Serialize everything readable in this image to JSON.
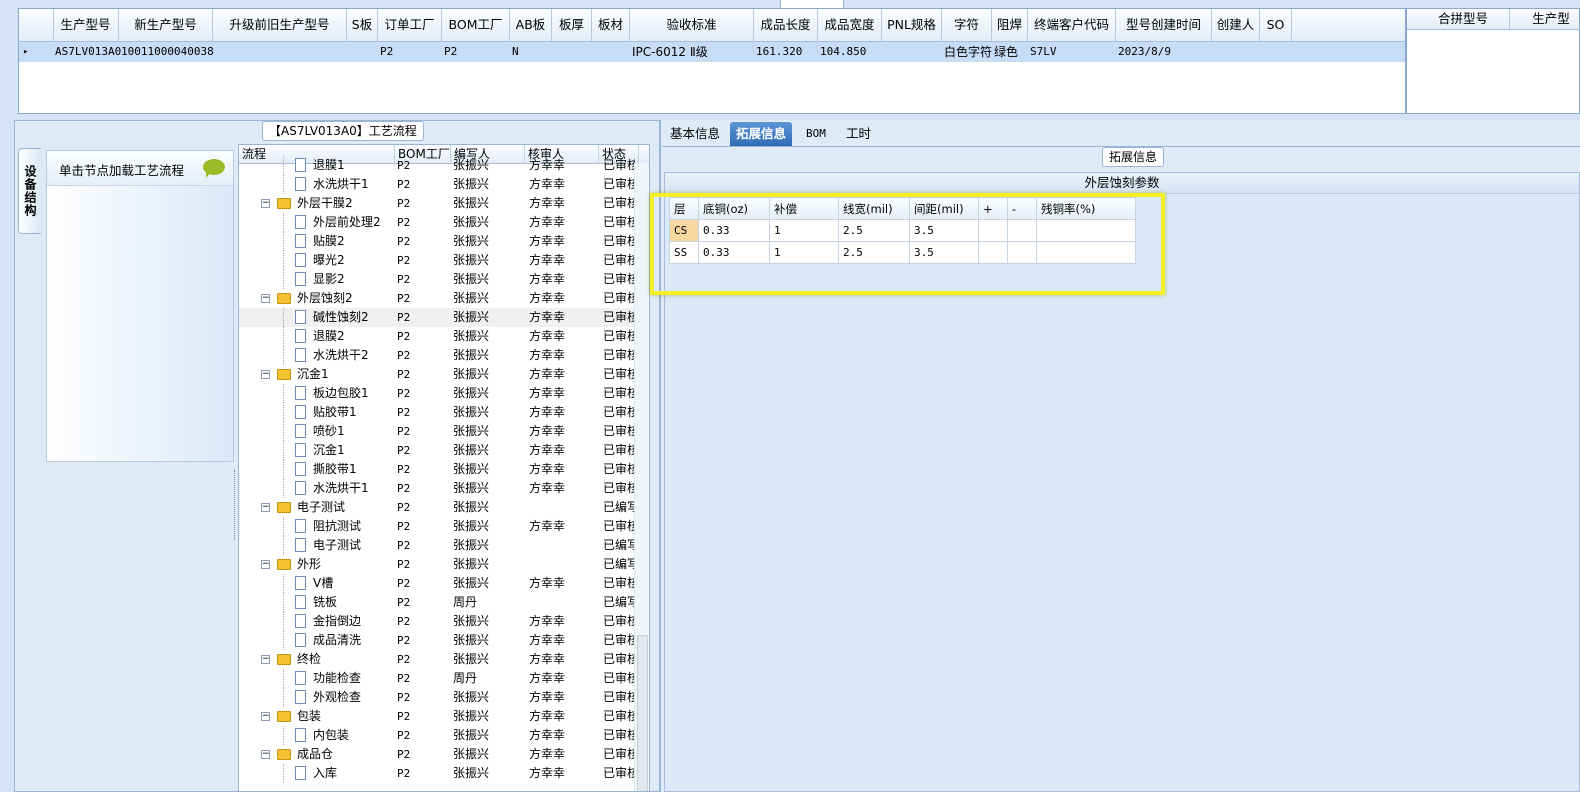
{
  "top_grid": {
    "columns": [
      "生产型号",
      "新生产型号",
      "升级前旧生产型号",
      "S板",
      "订单工厂",
      "BOM工厂",
      "AB板",
      "板厚",
      "板材",
      "验收标准",
      "成品长度",
      "成品宽度",
      "PNL规格",
      "字符",
      "阻焊",
      "终端客户代码",
      "型号创建时间",
      "创建人",
      "SO"
    ],
    "row": [
      "AS7LV013A0",
      "10011000040038",
      "",
      "",
      "P2",
      "P2",
      "N",
      "",
      "",
      "IPC-6012 Ⅱ级",
      "161.320",
      "104.850",
      "",
      "白色字符",
      "绿色",
      "S7LV",
      "2023/8/9",
      "",
      ""
    ]
  },
  "right_grid": {
    "columns": [
      "合拼型号",
      "生产型"
    ]
  },
  "left_panel": {
    "title": "【AS7LV013A0】工艺流程",
    "vertical_tab": "设备结构",
    "hint": "单击节点加载工艺流程"
  },
  "tree": {
    "columns": [
      "流程",
      "BOM工厂",
      "编写人",
      "核审人",
      "状态"
    ],
    "rows": [
      {
        "name": "退膜1",
        "level": 2,
        "factory": "P2",
        "writer": "张振兴",
        "reviewer": "方幸幸",
        "status": "已审核"
      },
      {
        "name": "水洗烘干1",
        "level": 2,
        "factory": "P2",
        "writer": "张振兴",
        "reviewer": "方幸幸",
        "status": "已审核"
      },
      {
        "name": "外层干膜2",
        "level": 1,
        "factory": "P2",
        "writer": "张振兴",
        "reviewer": "方幸幸",
        "status": "已审核"
      },
      {
        "name": "外层前处理2",
        "level": 2,
        "factory": "P2",
        "writer": "张振兴",
        "reviewer": "方幸幸",
        "status": "已审核"
      },
      {
        "name": "贴膜2",
        "level": 2,
        "factory": "P2",
        "writer": "张振兴",
        "reviewer": "方幸幸",
        "status": "已审核"
      },
      {
        "name": "曝光2",
        "level": 2,
        "factory": "P2",
        "writer": "张振兴",
        "reviewer": "方幸幸",
        "status": "已审核"
      },
      {
        "name": "显影2",
        "level": 2,
        "factory": "P2",
        "writer": "张振兴",
        "reviewer": "方幸幸",
        "status": "已审核"
      },
      {
        "name": "外层蚀刻2",
        "level": 1,
        "factory": "P2",
        "writer": "张振兴",
        "reviewer": "方幸幸",
        "status": "已审核"
      },
      {
        "name": "碱性蚀刻2",
        "level": 2,
        "factory": "P2",
        "writer": "张振兴",
        "reviewer": "方幸幸",
        "status": "已审核",
        "selected": true
      },
      {
        "name": "退膜2",
        "level": 2,
        "factory": "P2",
        "writer": "张振兴",
        "reviewer": "方幸幸",
        "status": "已审核"
      },
      {
        "name": "水洗烘干2",
        "level": 2,
        "factory": "P2",
        "writer": "张振兴",
        "reviewer": "方幸幸",
        "status": "已审核"
      },
      {
        "name": "沉金1",
        "level": 1,
        "factory": "P2",
        "writer": "张振兴",
        "reviewer": "方幸幸",
        "status": "已审核"
      },
      {
        "name": "板边包胶1",
        "level": 2,
        "factory": "P2",
        "writer": "张振兴",
        "reviewer": "方幸幸",
        "status": "已审核"
      },
      {
        "name": "贴胶带1",
        "level": 2,
        "factory": "P2",
        "writer": "张振兴",
        "reviewer": "方幸幸",
        "status": "已审核"
      },
      {
        "name": "喷砂1",
        "level": 2,
        "factory": "P2",
        "writer": "张振兴",
        "reviewer": "方幸幸",
        "status": "已审核"
      },
      {
        "name": "沉金1",
        "level": 2,
        "factory": "P2",
        "writer": "张振兴",
        "reviewer": "方幸幸",
        "status": "已审核"
      },
      {
        "name": "撕胶带1",
        "level": 2,
        "factory": "P2",
        "writer": "张振兴",
        "reviewer": "方幸幸",
        "status": "已审核"
      },
      {
        "name": "水洗烘干1",
        "level": 2,
        "factory": "P2",
        "writer": "张振兴",
        "reviewer": "方幸幸",
        "status": "已审核"
      },
      {
        "name": "电子测试",
        "level": 1,
        "factory": "P2",
        "writer": "张振兴",
        "reviewer": "",
        "status": "已编写"
      },
      {
        "name": "阻抗测试",
        "level": 2,
        "factory": "P2",
        "writer": "张振兴",
        "reviewer": "方幸幸",
        "status": "已审核"
      },
      {
        "name": "电子测试",
        "level": 2,
        "factory": "P2",
        "writer": "张振兴",
        "reviewer": "",
        "status": "已编写"
      },
      {
        "name": "外形",
        "level": 1,
        "factory": "P2",
        "writer": "张振兴",
        "reviewer": "",
        "status": "已编写"
      },
      {
        "name": "V槽",
        "level": 2,
        "factory": "P2",
        "writer": "张振兴",
        "reviewer": "方幸幸",
        "status": "已审核"
      },
      {
        "name": "铣板",
        "level": 2,
        "factory": "P2",
        "writer": "周丹",
        "reviewer": "",
        "status": "已编写"
      },
      {
        "name": "金指倒边",
        "level": 2,
        "factory": "P2",
        "writer": "张振兴",
        "reviewer": "方幸幸",
        "status": "已审核"
      },
      {
        "name": "成品清洗",
        "level": 2,
        "factory": "P2",
        "writer": "张振兴",
        "reviewer": "方幸幸",
        "status": "已审核"
      },
      {
        "name": "终检",
        "level": 1,
        "factory": "P2",
        "writer": "张振兴",
        "reviewer": "方幸幸",
        "status": "已审核"
      },
      {
        "name": "功能检查",
        "level": 2,
        "factory": "P2",
        "writer": "周丹",
        "reviewer": "方幸幸",
        "status": "已审核"
      },
      {
        "name": "外观检查",
        "level": 2,
        "factory": "P2",
        "writer": "张振兴",
        "reviewer": "方幸幸",
        "status": "已审核"
      },
      {
        "name": "包装",
        "level": 1,
        "factory": "P2",
        "writer": "张振兴",
        "reviewer": "方幸幸",
        "status": "已审核"
      },
      {
        "name": "内包装",
        "level": 2,
        "factory": "P2",
        "writer": "张振兴",
        "reviewer": "方幸幸",
        "status": "已审核"
      },
      {
        "name": "成品仓",
        "level": 1,
        "factory": "P2",
        "writer": "张振兴",
        "reviewer": "方幸幸",
        "status": "已审核"
      },
      {
        "name": "入库",
        "level": 2,
        "factory": "P2",
        "writer": "张振兴",
        "reviewer": "方幸幸",
        "status": "已审核"
      }
    ]
  },
  "tabs": [
    {
      "label": "基本信息",
      "active": false
    },
    {
      "label": "拓展信息",
      "active": true
    },
    {
      "label": "BOM",
      "active": false
    },
    {
      "label": "工时",
      "active": false
    }
  ],
  "ext": {
    "group_title": "拓展信息",
    "panel_title": "外层蚀刻参数",
    "columns": [
      "层",
      "底铜(oz)",
      "补偿",
      "线宽(mil)",
      "间距(mil)",
      "+",
      "-",
      "残铜率(%)"
    ],
    "rows": [
      [
        "CS",
        "0.33",
        "1",
        "2.5",
        "3.5",
        "",
        "",
        ""
      ],
      [
        "SS",
        "0.33",
        "1",
        "2.5",
        "3.5",
        "",
        "",
        ""
      ]
    ]
  },
  "colors": {
    "highlight": "#f3f125",
    "selected_row": "#c7dcf5",
    "active_tab": "#2f6bb6"
  }
}
